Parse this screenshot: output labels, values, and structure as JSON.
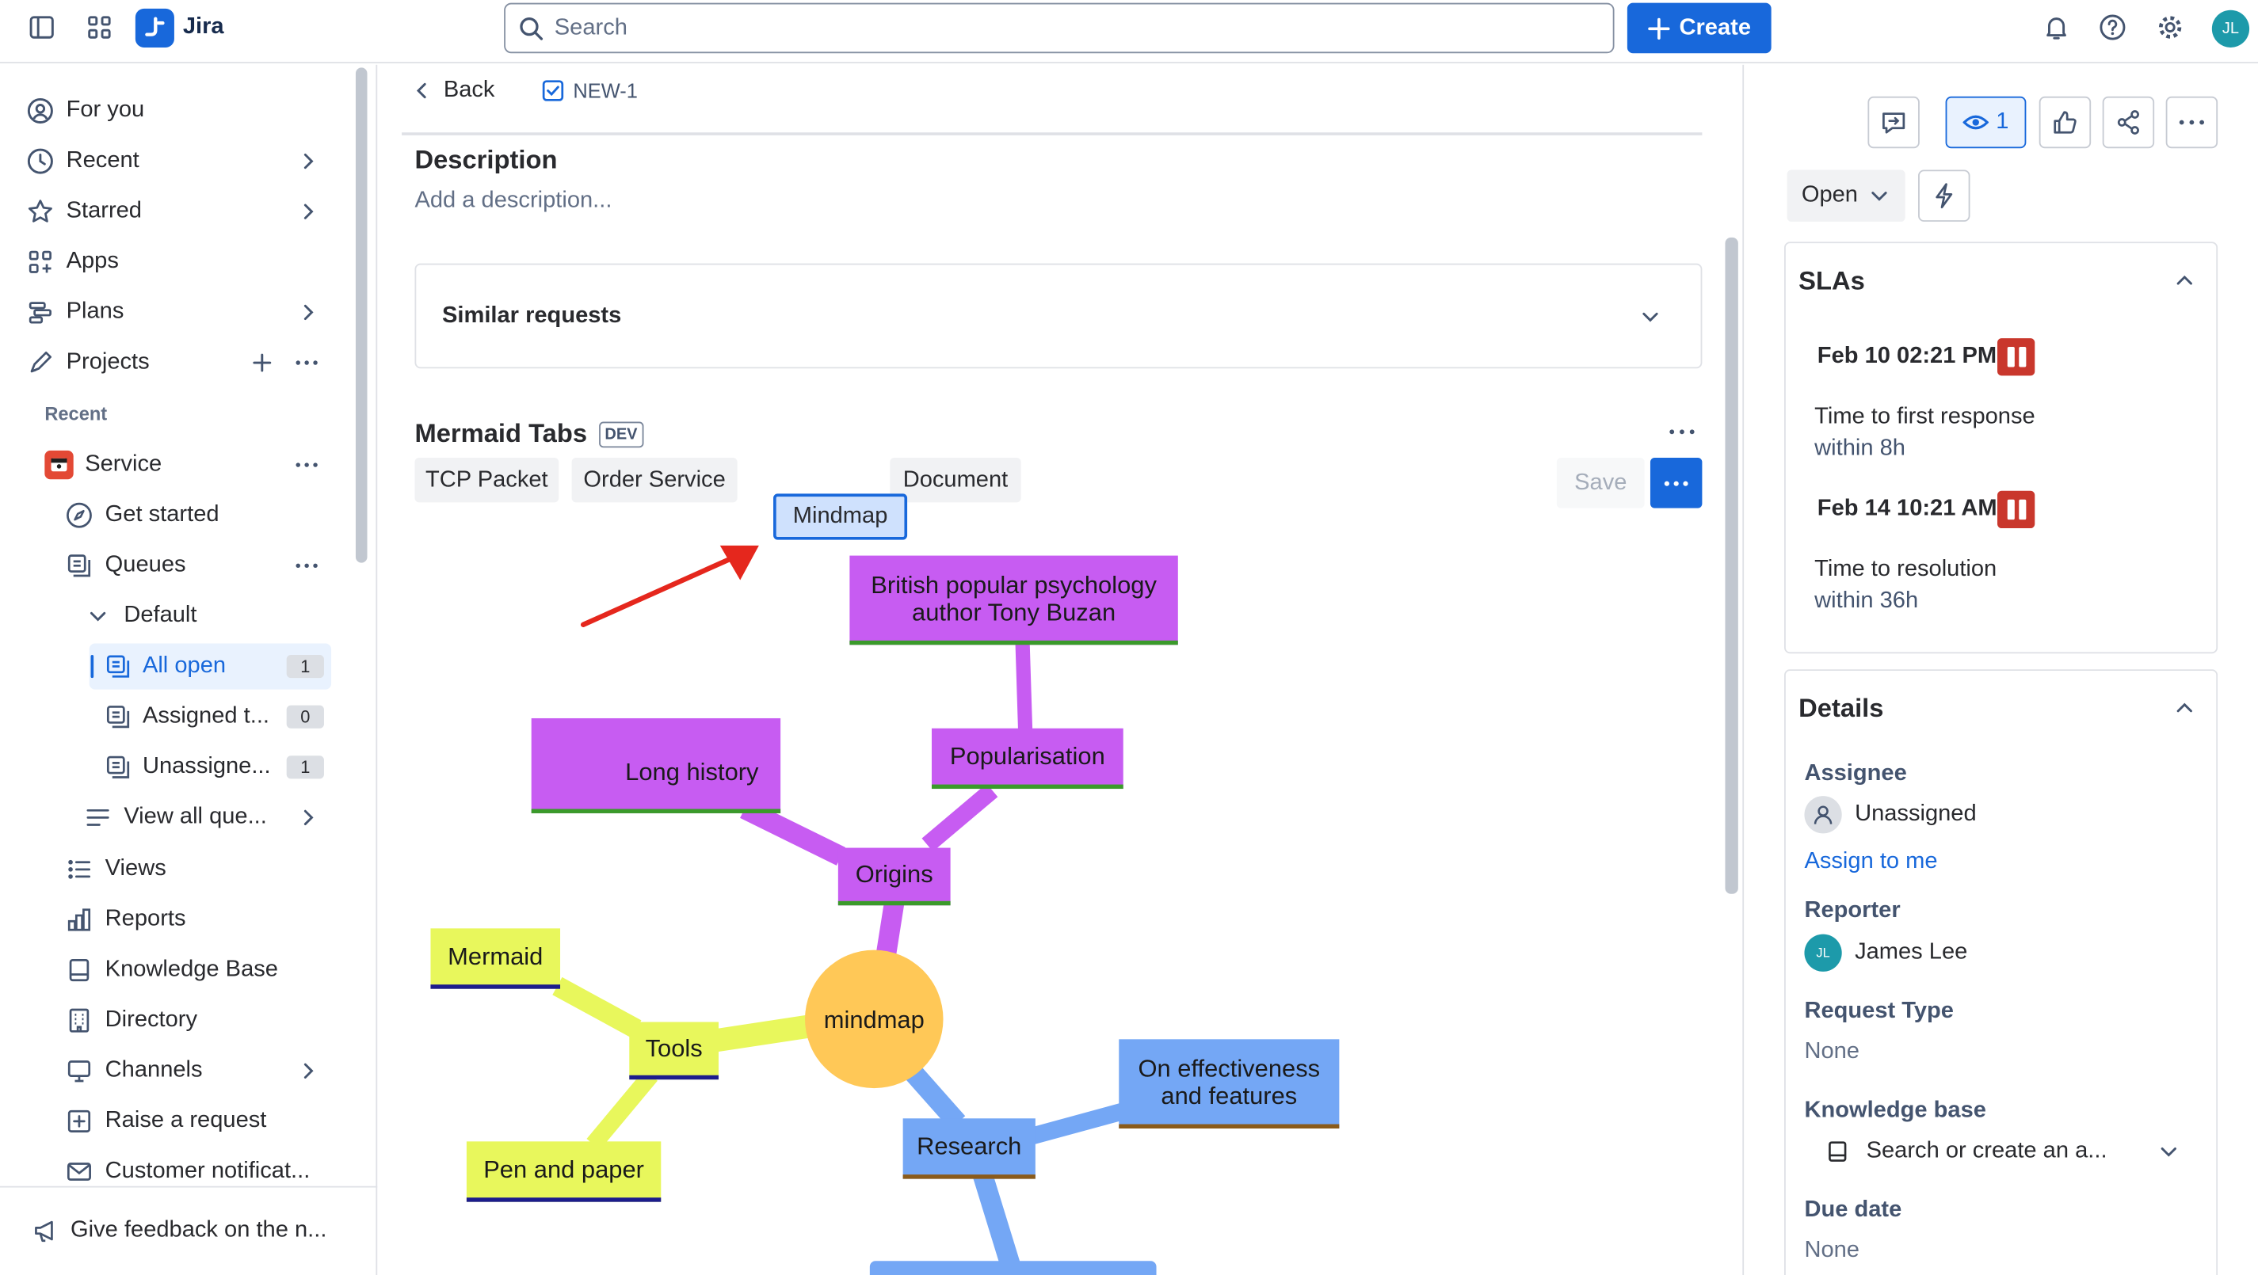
{
  "topbar": {
    "app_name": "Jira",
    "search_placeholder": "Search",
    "create_label": "Create",
    "user_initials": "JL"
  },
  "sidebar": {
    "items": [
      {
        "label": "For you"
      },
      {
        "label": "Recent"
      },
      {
        "label": "Starred"
      },
      {
        "label": "Apps"
      },
      {
        "label": "Plans"
      },
      {
        "label": "Projects"
      }
    ],
    "recent_heading": "Recent",
    "project": {
      "label": "Service"
    },
    "project_items": [
      {
        "label": "Get started"
      },
      {
        "label": "Queues"
      },
      {
        "label": "Default"
      },
      {
        "label": "All open",
        "count": "1"
      },
      {
        "label": "Assigned t...",
        "count": "0"
      },
      {
        "label": "Unassigne...",
        "count": "1"
      },
      {
        "label": "View all que..."
      },
      {
        "label": "Views"
      },
      {
        "label": "Reports"
      },
      {
        "label": "Knowledge Base"
      },
      {
        "label": "Directory"
      },
      {
        "label": "Channels"
      },
      {
        "label": "Raise a request"
      },
      {
        "label": "Customer notificat..."
      }
    ],
    "feedback": "Give feedback on the n..."
  },
  "main": {
    "back_label": "Back",
    "issue_key": "NEW-1",
    "description_heading": "Description",
    "description_placeholder": "Add a description...",
    "similar_requests": "Similar requests",
    "mermaid": {
      "title": "Mermaid Tabs",
      "badge": "DEV",
      "tabs": [
        "TCP Packet",
        "Order Service",
        "Document"
      ],
      "active_tab": "Mindmap",
      "save_label": "Save"
    },
    "mindmap": {
      "root": "mindmap",
      "nodes": {
        "origins": "Origins",
        "long_history": "Long history",
        "popularisation": "Popularisation",
        "buzan": "British popular psychology author Tony Buzan",
        "research": "Research",
        "effectiveness": "On effectiveness and features",
        "tools": "Tools",
        "pen_paper": "Pen and paper",
        "mermaid": "Mermaid"
      },
      "colors": {
        "root": "#ffc857",
        "origins_branch": "#c75cf2",
        "tools_branch": "#e8f75c",
        "research_branch": "#74a7f5"
      }
    }
  },
  "right_panel": {
    "watch_count": "1",
    "status": "Open",
    "slas": {
      "heading": "SLAs",
      "items": [
        {
          "time": "Feb 10 02:21 PM",
          "name": "Time to first response",
          "goal": "within 8h"
        },
        {
          "time": "Feb 14 10:21 AM",
          "name": "Time to resolution",
          "goal": "within 36h"
        }
      ]
    },
    "details": {
      "heading": "Details",
      "assignee_label": "Assignee",
      "assignee_value": "Unassigned",
      "assign_to_me": "Assign to me",
      "reporter_label": "Reporter",
      "reporter_value": "James Lee",
      "reporter_initials": "JL",
      "request_type_label": "Request Type",
      "request_type_value": "None",
      "kb_label": "Knowledge base",
      "kb_placeholder": "Search or create an a...",
      "due_date_label": "Due date",
      "due_date_value": "None"
    }
  }
}
